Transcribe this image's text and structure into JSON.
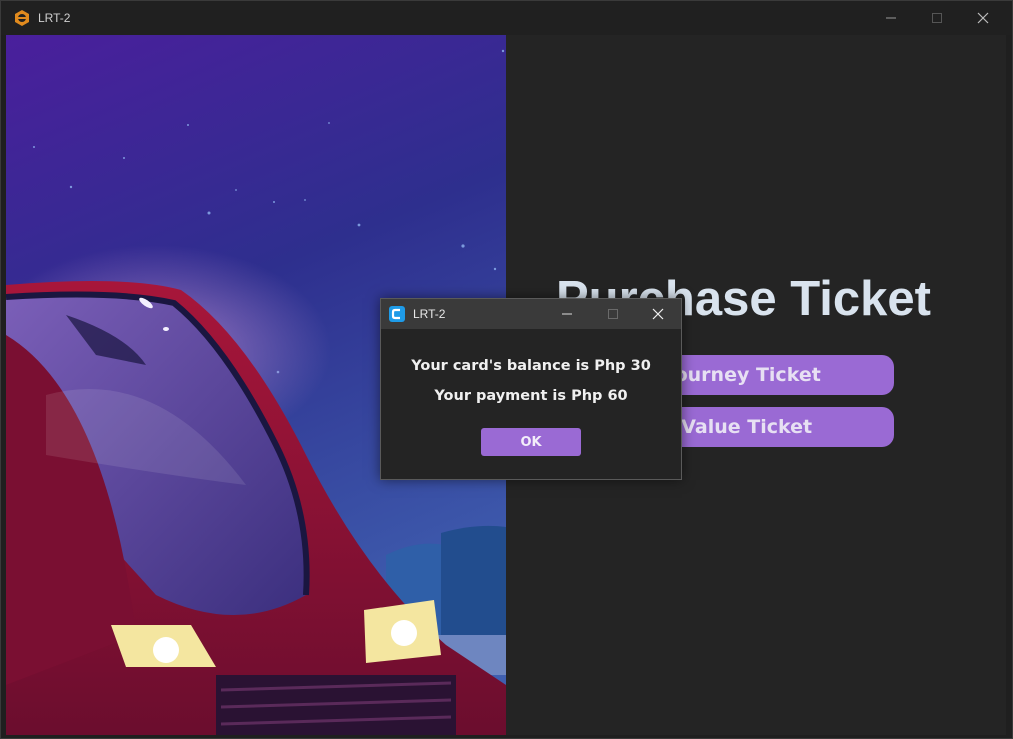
{
  "window": {
    "title": "LRT-2",
    "controls": {
      "minimize": "minimize-icon",
      "maximize": "maximize-icon",
      "close": "close-icon"
    }
  },
  "main": {
    "heading": "Purchase Ticket",
    "buttons": [
      {
        "label": "Single Journey Ticket"
      },
      {
        "label": "Stored Value Ticket"
      }
    ]
  },
  "dialog": {
    "title": "LRT-2",
    "lines": [
      "Your card's balance is Php 30",
      "Your payment is Php 60"
    ],
    "ok_label": "OK"
  },
  "colors": {
    "accent": "#9a6ad4",
    "background": "#242424",
    "heading": "#d9e3ee"
  }
}
